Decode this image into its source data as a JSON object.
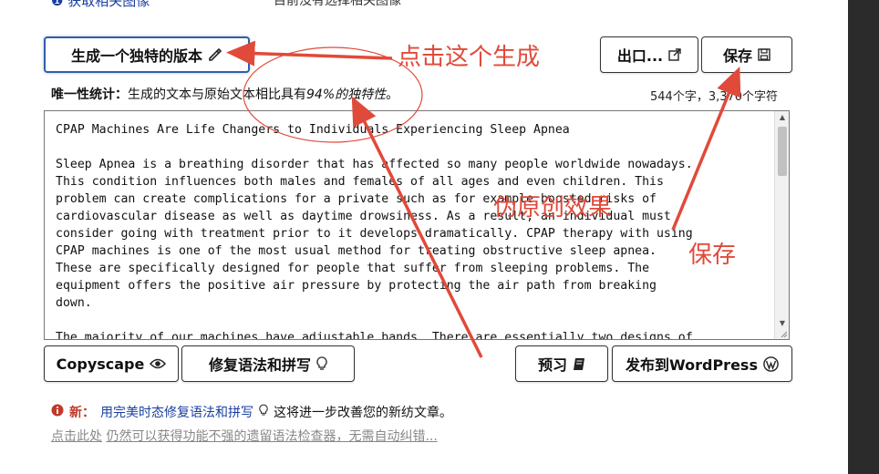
{
  "top": {
    "left_text": "❶ 获取相关图像",
    "right_text": "目前没有选择相关图像"
  },
  "buttons": {
    "generate": "生成一个独特的版本",
    "export": "出口...",
    "save": "保存",
    "copyscape": "Copyscape",
    "fix_grammar": "修复语法和拼写",
    "preview": "预习",
    "publish": "发布到WordPress"
  },
  "stats": {
    "label": "唯一性统计：",
    "text_before": "生成的文本与原始文本相比具有",
    "percent_text": "94%的独特性",
    "text_after": "。",
    "counts": "544个字，3,370个字符"
  },
  "editor": {
    "content": "CPAP Machines Are Life Changers to Individuals Experiencing Sleep Apnea\n\nSleep Apnea is a breathing disorder that has affected so many people worldwide nowadays.\nThis condition influences both males and females of all ages and even children. This\nproblem can create complications for a private such as for example boosted risks of\ncardiovascular disease as well as daytime drowsiness. As a result, an individual must\nconsider going with treatment prior to it develops dramatically. CPAP therapy with using\nCPAP machines is one of the most usual method for treating obstructive sleep apnea.\nThese are specifically designed for people that suffer from sleeping problems. The\nequipment offers the positive air pressure by protecting the air path from breaking\ndown.\n\nThe majority of our machines have adjustable bands. There are essentially two designs of"
  },
  "notice": {
    "new_label": "新：",
    "link": "用完美时态修复语法和拼写",
    "text": "这将进一步改善您的新纺文章。"
  },
  "legacy": {
    "link": "点击此处",
    "text": "仍然可以获得功能不强的遗留语法检查器，无需自动纠错..."
  },
  "annotations": {
    "click_generate": "点击这个生成",
    "pseudo_original": "伪原创效果",
    "save": "保存"
  },
  "colors": {
    "annotation": "#e04a3a",
    "primary_border": "#2f5fa8",
    "link_blue": "#1a3fa0",
    "alert_red": "#c0392b"
  }
}
